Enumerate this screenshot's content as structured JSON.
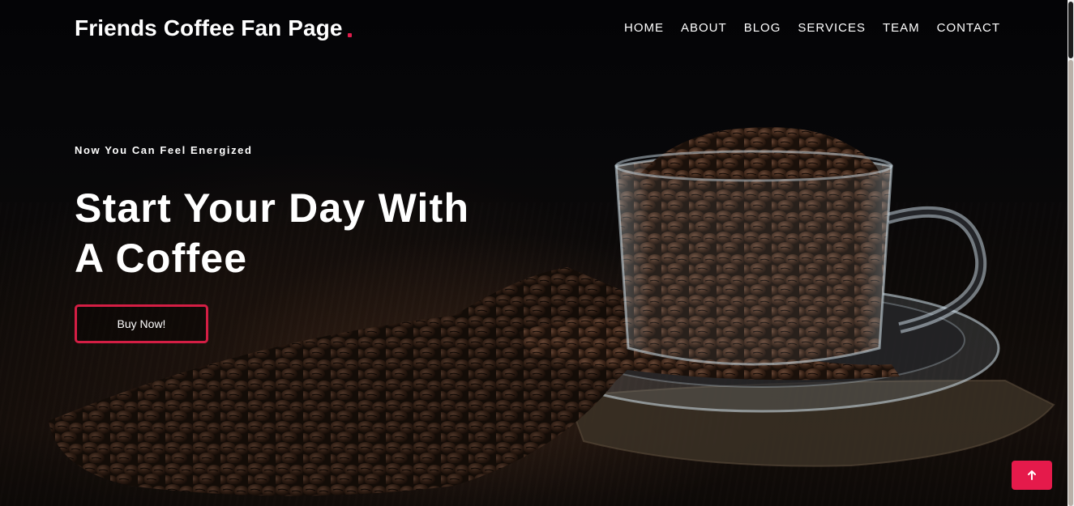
{
  "header": {
    "brand": "Friends Coffee Fan Page",
    "nav": [
      "HOME",
      "ABOUT",
      "BLOG",
      "SERVICES",
      "TEAM",
      "CONTACT"
    ]
  },
  "hero": {
    "tagline": "Now You Can Feel Energized",
    "headline_line1": "Start Your Day With",
    "headline_line2": "A Coffee",
    "cta_label": "Buy Now!"
  },
  "illustration": {
    "subject": "glass cup of coffee beans on a saucer with scattered beans",
    "icon": "coffee-cup-illustration"
  },
  "back_to_top": {
    "icon": "arrow-up-icon"
  },
  "colors": {
    "accent": "#e51a4b",
    "button_border": "#d41e44",
    "background": "#050507",
    "text": "#ffffff"
  }
}
